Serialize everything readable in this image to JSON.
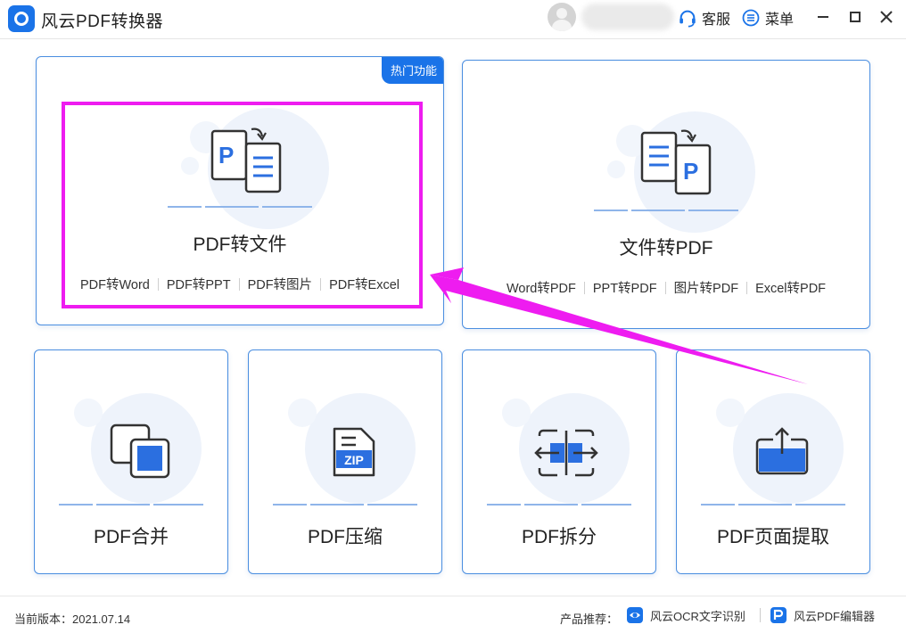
{
  "app": {
    "title": "风云PDF转换器",
    "service_label": "客服",
    "menu_label": "菜单",
    "accent_color": "#1a73e8"
  },
  "cards": {
    "pdf_to_file": {
      "badge": "热门功能",
      "title": "PDF转文件",
      "links": [
        "PDF转Word",
        "PDF转PPT",
        "PDF转图片",
        "PDF转Excel"
      ],
      "icon": "pdf-to-doc-icon"
    },
    "file_to_pdf": {
      "title": "文件转PDF",
      "links": [
        "Word转PDF",
        "PPT转PDF",
        "图片转PDF",
        "Excel转PDF"
      ],
      "icon": "doc-to-pdf-icon"
    },
    "merge": {
      "title": "PDF合并",
      "icon": "merge-icon"
    },
    "compress": {
      "title": "PDF压缩",
      "icon": "zip-icon",
      "icon_text": "ZIP"
    },
    "split": {
      "title": "PDF拆分",
      "icon": "split-icon"
    },
    "extract": {
      "title": "PDF页面提取",
      "icon": "extract-icon"
    }
  },
  "footer": {
    "version_label": "当前版本：",
    "version": "2021.07.14",
    "recommend_label": "产品推荐：",
    "products": [
      {
        "label": "风云OCR文字识别",
        "icon": "ocr-eye-icon"
      },
      {
        "label": "风云PDF编辑器",
        "icon": "pdf-editor-icon"
      }
    ]
  },
  "annotation": {
    "highlight_color": "#ee1cf0"
  }
}
